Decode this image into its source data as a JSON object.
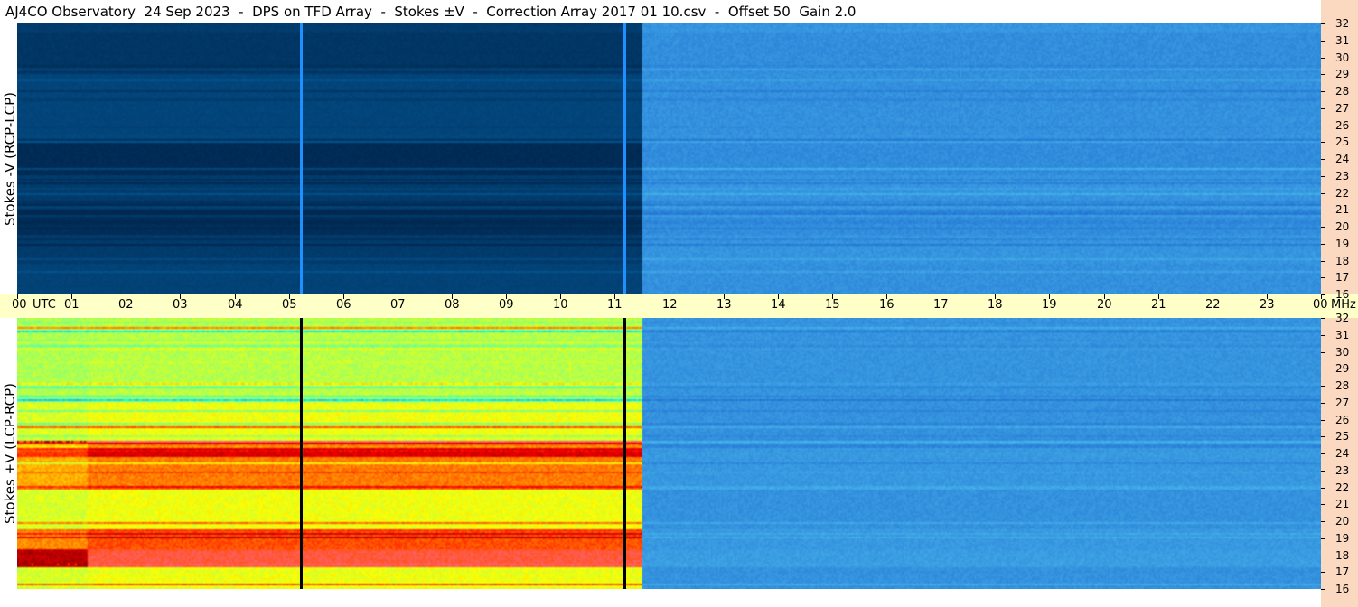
{
  "title": "AJ4CO Observatory  24 Sep 2023  -  DPS on TFD Array  -  Stokes ±V  -  Correction Array 2017 01 10.csv  -  Offset 50  Gain 2.0",
  "chart_data": [
    {
      "type": "heatmap",
      "ylabel": "Stokes -V (RCP-LCP)",
      "x_unit": "UTC",
      "y_unit": "MHz",
      "x_ticks": [
        "00",
        "01",
        "02",
        "03",
        "04",
        "05",
        "06",
        "07",
        "08",
        "09",
        "10",
        "11",
        "12",
        "13",
        "14",
        "15",
        "16",
        "17",
        "18",
        "19",
        "20",
        "21",
        "22",
        "23",
        "00"
      ],
      "xlim_hours": [
        0,
        24
      ],
      "y_ticks": [
        16,
        17,
        18,
        19,
        20,
        21,
        22,
        23,
        24,
        25,
        26,
        27,
        28,
        29,
        30,
        31,
        32
      ],
      "ylim_mhz": [
        16,
        32
      ],
      "segments": [
        {
          "from_hour": 0,
          "to_hour": 11.5,
          "level": 0.16,
          "colormap": "dark-blue"
        },
        {
          "from_hour": 11.5,
          "to_hour": 24,
          "level": 0.42,
          "colormap": "blue"
        }
      ],
      "bands": [
        {
          "from_mhz": 16,
          "to_mhz": 17.8,
          "level": 0.22
        },
        {
          "from_mhz": 19.5,
          "to_mhz": 21,
          "level": 0.05
        },
        {
          "from_mhz": 23,
          "to_mhz": 25,
          "level": 0.03
        },
        {
          "from_mhz": 25,
          "to_mhz": 29,
          "level": 0.24
        },
        {
          "from_mhz": 29,
          "to_mhz": 31.5,
          "level": 0.12
        }
      ],
      "vertical_lines": [
        {
          "hour": 5.22,
          "color": "#1e90ff"
        },
        {
          "hour": 11.17,
          "color": "#1e90ff"
        }
      ]
    },
    {
      "type": "heatmap",
      "ylabel": "Stokes +V (LCP-RCP)",
      "x_unit": "UTC",
      "y_unit": "MHz",
      "x_ticks": [
        "00",
        "01",
        "02",
        "03",
        "04",
        "05",
        "06",
        "07",
        "08",
        "09",
        "10",
        "11",
        "12",
        "13",
        "14",
        "15",
        "16",
        "17",
        "18",
        "19",
        "20",
        "21",
        "22",
        "23",
        "00"
      ],
      "xlim_hours": [
        0,
        24
      ],
      "y_ticks": [
        16,
        17,
        18,
        19,
        20,
        21,
        22,
        23,
        24,
        25,
        26,
        27,
        28,
        29,
        30,
        31,
        32
      ],
      "ylim_mhz": [
        16,
        32
      ],
      "segments": [
        {
          "from_hour": 0,
          "to_hour": 11.5,
          "level": 0.55,
          "colormap": "jet"
        },
        {
          "from_hour": 11.5,
          "to_hour": 24,
          "level": 0.4,
          "colormap": "blue"
        }
      ],
      "bands": [
        {
          "from_mhz": 17.3,
          "to_mhz": 18.3,
          "level": 0.95
        },
        {
          "from_mhz": 18.3,
          "to_mhz": 19.5,
          "level": 0.72
        },
        {
          "from_mhz": 23.8,
          "to_mhz": 24.8,
          "level": 0.82
        },
        {
          "from_mhz": 22,
          "to_mhz": 23.8,
          "level": 0.68
        },
        {
          "from_mhz": 27,
          "to_mhz": 32,
          "level": 0.5
        }
      ],
      "vertical_lines": [
        {
          "hour": 5.22,
          "color": "#000000"
        },
        {
          "hour": 11.17,
          "color": "#000000"
        }
      ]
    }
  ],
  "colors": {
    "time_strip": "#ffffc8",
    "freq_strip": "#fbd9c0"
  }
}
